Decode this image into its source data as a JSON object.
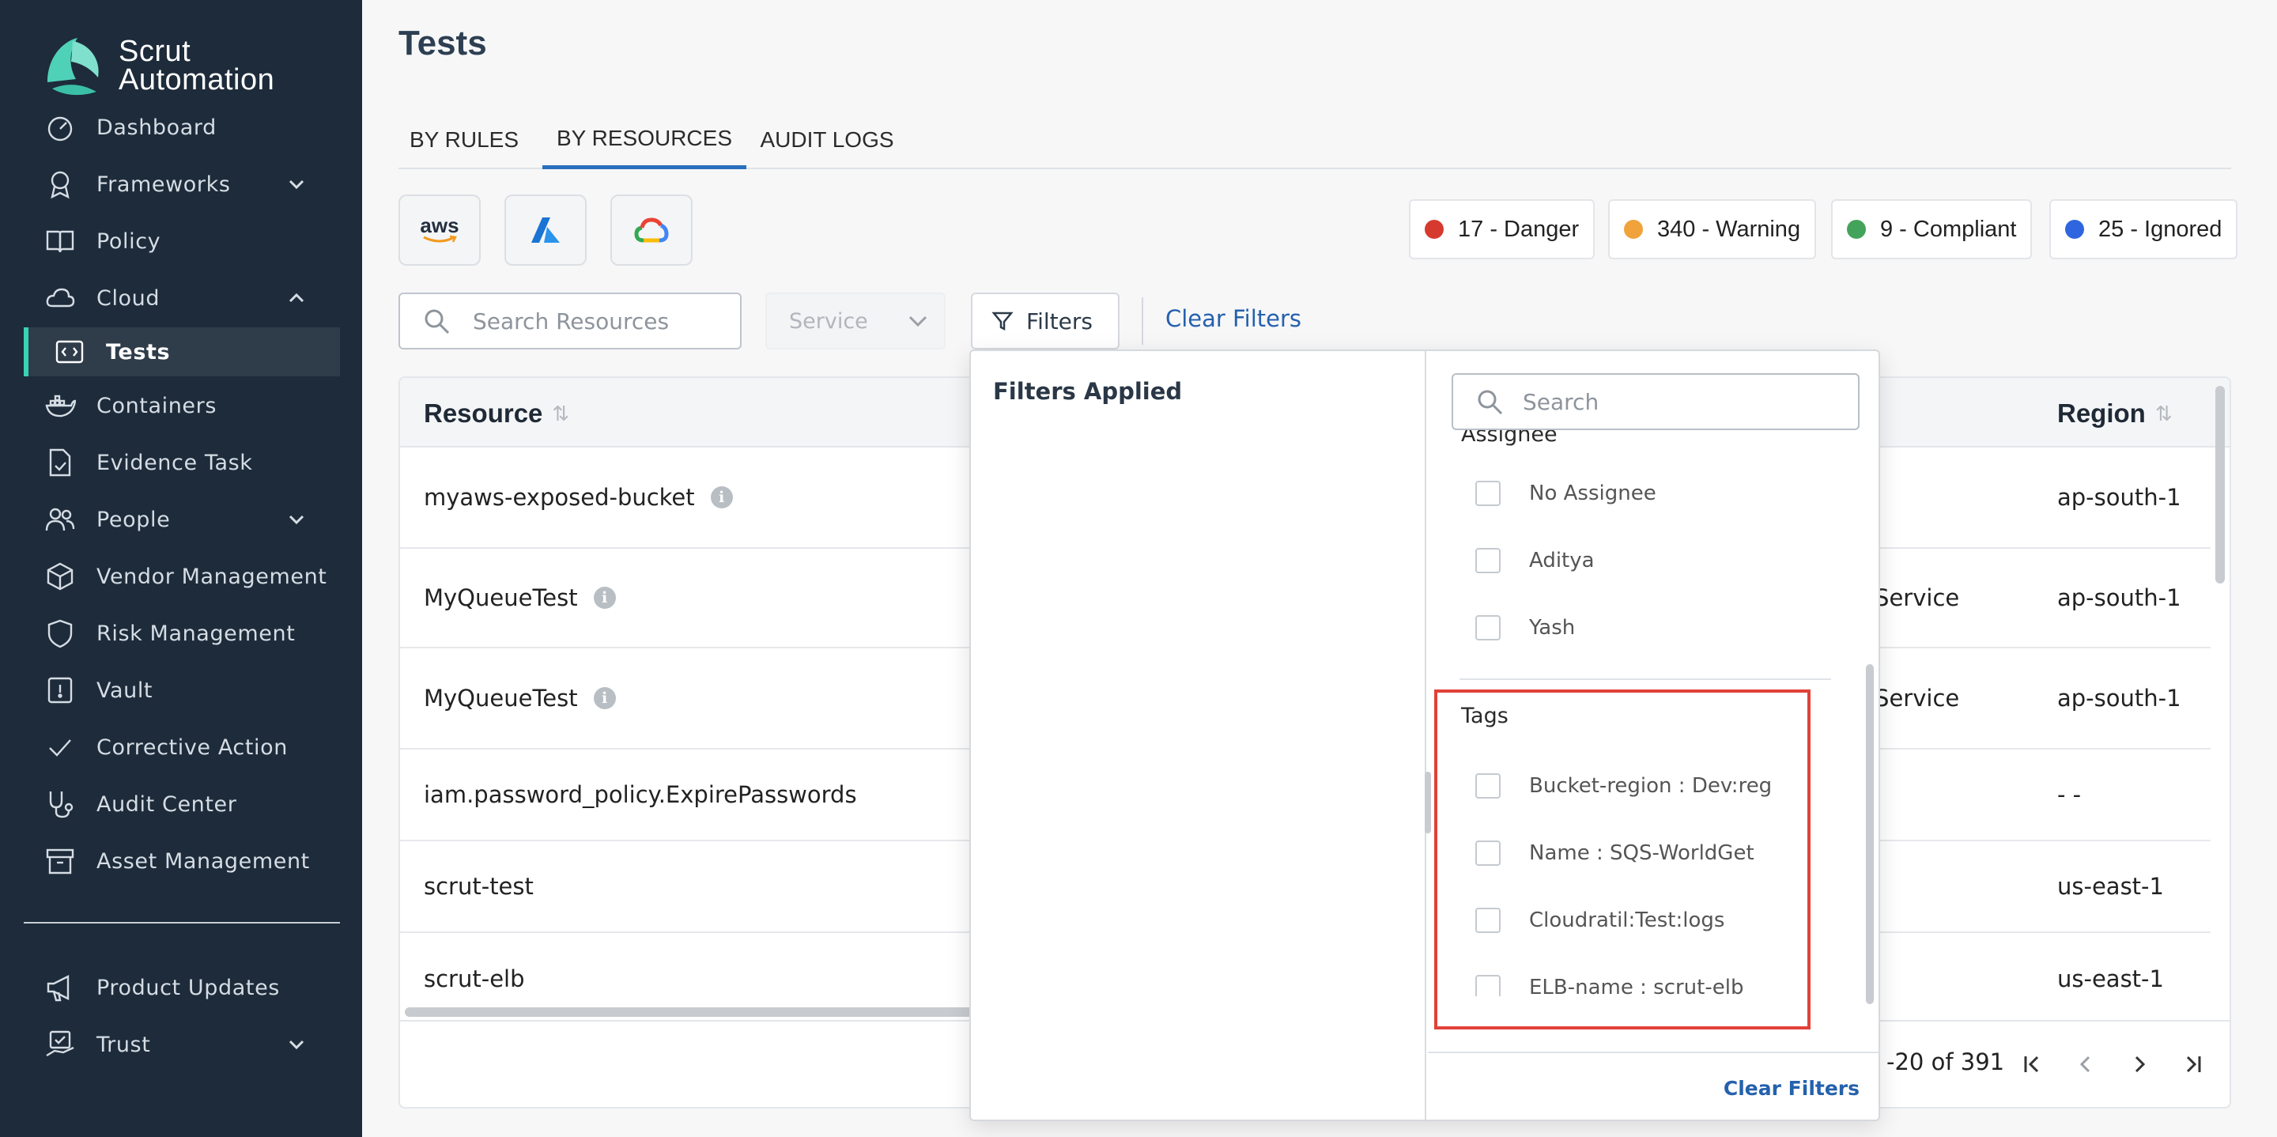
{
  "brand": {
    "line1": "Scrut",
    "line2": "Automation"
  },
  "sidebar": {
    "items": [
      {
        "label": "Dashboard",
        "icon": "dashboard-icon"
      },
      {
        "label": "Frameworks",
        "icon": "award-icon",
        "expandable": true
      },
      {
        "label": "Policy",
        "icon": "book-icon"
      },
      {
        "label": "Cloud",
        "icon": "cloud-icon",
        "expanded": true
      },
      {
        "label": "Tests",
        "icon": "code-icon",
        "active": true
      },
      {
        "label": "Containers",
        "icon": "docker-icon"
      },
      {
        "label": "Evidence Task",
        "icon": "document-check-icon"
      },
      {
        "label": "People",
        "icon": "people-icon",
        "expandable": true
      },
      {
        "label": "Vendor Management",
        "icon": "box-icon"
      },
      {
        "label": "Risk Management",
        "icon": "shield-icon"
      },
      {
        "label": "Vault",
        "icon": "vault-icon"
      },
      {
        "label": "Corrective Action",
        "icon": "check-icon"
      },
      {
        "label": "Audit Center",
        "icon": "stethoscope-icon"
      },
      {
        "label": "Asset Management",
        "icon": "archive-icon"
      },
      {
        "label": "Product Updates",
        "icon": "megaphone-icon"
      },
      {
        "label": "Trust",
        "icon": "trust-icon",
        "expandable": true
      }
    ]
  },
  "page": {
    "title": "Tests"
  },
  "tabs": [
    {
      "label": "BY RULES"
    },
    {
      "label": "BY RESOURCES",
      "active": true
    },
    {
      "label": "AUDIT LOGS"
    }
  ],
  "cloud_providers": {
    "aws_label": "aws"
  },
  "status": [
    {
      "label": "17 - Danger",
      "color": "#d63a2f"
    },
    {
      "label": "340 - Warning",
      "color": "#f0a33a"
    },
    {
      "label": "9 - Compliant",
      "color": "#44a35a"
    },
    {
      "label": "25 - Ignored",
      "color": "#2f66e0"
    }
  ],
  "toolbar": {
    "search_placeholder": "Search Resources",
    "service_placeholder": "Service",
    "filters_label": "Filters",
    "clear_filters_label": "Clear Filters"
  },
  "table": {
    "headers": {
      "resource": "Resource",
      "region": "Region"
    },
    "rows": [
      {
        "resource": "myaws-exposed-bucket",
        "info": true,
        "service": "",
        "region": "ap-south-1"
      },
      {
        "resource": "MyQueueTest",
        "info": true,
        "service": "e Service",
        "region": "ap-south-1"
      },
      {
        "resource": "MyQueueTest",
        "info": true,
        "service": "e Service",
        "region": "ap-south-1"
      },
      {
        "resource": "iam.password_policy.ExpirePasswords",
        "info": false,
        "service": "",
        "region": "- -"
      },
      {
        "resource": "scrut-test",
        "info": false,
        "service": "",
        "region": "us-east-1"
      },
      {
        "resource": "scrut-elb",
        "info": false,
        "service": "",
        "region": "us-east-1"
      }
    ],
    "pagination": {
      "range": "-20 of 391"
    }
  },
  "filter_panel": {
    "applied_title": "Filters Applied",
    "search_placeholder": "Search",
    "assignee_group": {
      "title": "Assignee",
      "options": [
        "No Assignee",
        "Aditya",
        "Yash"
      ]
    },
    "tags_group": {
      "title": "Tags",
      "options": [
        "Bucket-region : Dev:reg",
        "Name : SQS-WorldGet",
        "Cloudratil:Test:logs",
        "ELB-name : scrut-elb"
      ]
    },
    "clear_label": "Clear Filters"
  }
}
